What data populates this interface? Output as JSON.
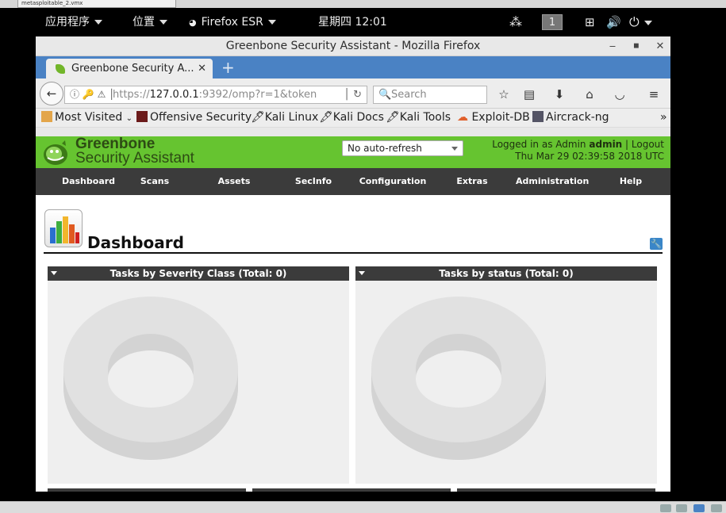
{
  "host": {
    "tab_label": "metasploitable_2.vmx"
  },
  "panel": {
    "applications": "应用程序",
    "places": "位置",
    "app_menu": "Firefox ESR",
    "clock": "星期四 12:01",
    "workspace": "1"
  },
  "window": {
    "title": "Greenbone Security Assistant - Mozilla Firefox",
    "tab_title": "Greenbone Security A...",
    "url_prefix": "https://",
    "url_host": "127.0.0.1",
    "url_rest": ":9392/omp?r=1&token",
    "search_placeholder": "Search"
  },
  "bookmarks": [
    {
      "label": "Most Visited",
      "icon": "folder-icon"
    },
    {
      "label": "Offensive Security",
      "icon": "offsec-icon"
    },
    {
      "label": "Kali Linux",
      "icon": "kali-icon"
    },
    {
      "label": "Kali Docs",
      "icon": "kali-icon"
    },
    {
      "label": "Kali Tools",
      "icon": "kali-icon"
    },
    {
      "label": "Exploit-DB",
      "icon": "exploitdb-icon"
    },
    {
      "label": "Aircrack-ng",
      "icon": "aircrack-icon"
    }
  ],
  "gsa": {
    "logo_line1": "Greenbone",
    "logo_line2": "Security Assistant",
    "refresh_value": "No auto-refresh",
    "logged_in_prefix": "Logged in as",
    "role": "Admin",
    "user": "admin",
    "logout": "Logout",
    "datetime": "Thu Mar 29 02:39:58 2018 UTC",
    "menu": [
      "Dashboard",
      "Scans",
      "Assets",
      "SecInfo",
      "Configuration",
      "Extras",
      "Administration",
      "Help"
    ],
    "page_title": "Dashboard",
    "charts": [
      {
        "title": "Tasks by Severity Class (Total: 0)"
      },
      {
        "title": "Tasks by status (Total: 0)"
      }
    ]
  },
  "colors": {
    "gsa_green": "#66c430",
    "menu_dark": "#3b3b3b",
    "tab_blue": "#4a82c4"
  }
}
